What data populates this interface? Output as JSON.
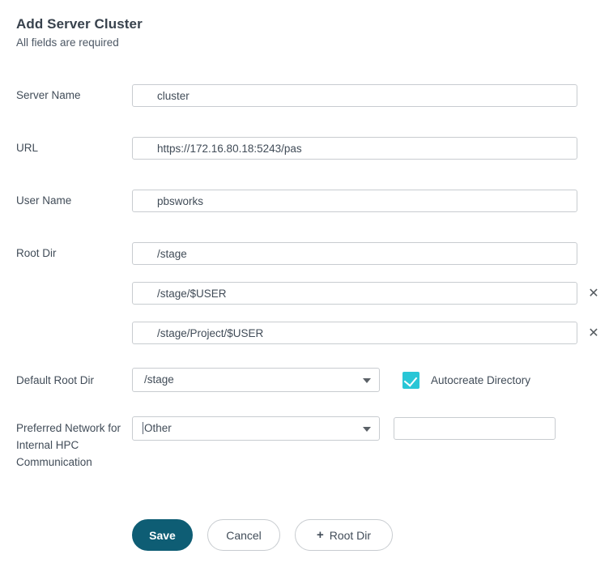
{
  "header": {
    "title": "Add Server Cluster",
    "subtitle": "All fields are required"
  },
  "fields": {
    "server_name": {
      "label": "Server Name",
      "value": "cluster",
      "placeholder": ""
    },
    "url": {
      "label": "URL",
      "value": "https://172.16.80.18:5243/pas",
      "placeholder": ""
    },
    "user_name": {
      "label": "User Name",
      "value": "pbsworks",
      "placeholder": ""
    },
    "root_dir": {
      "label": "Root Dir",
      "values": [
        "/stage",
        "/stage/$USER",
        "/stage/Project/$USER"
      ],
      "remove_icon": "✕",
      "remove_icon_name": "close-icon"
    },
    "default_root_dir": {
      "label": "Default Root Dir",
      "selected": "/stage",
      "options": [
        "/stage",
        "/stage/$USER",
        "/stage/Project/$USER"
      ],
      "caret_icon": "chevron-down-icon"
    },
    "autocreate_directory": {
      "label": "Autocreate Directory",
      "checked": true,
      "checkbox_color": "#29c6d6"
    },
    "preferred_network": {
      "label": "Preferred Network for Internal HPC Communication",
      "selected": "Other",
      "options": [
        "Other"
      ],
      "caret_icon": "chevron-down-icon",
      "custom_value": "",
      "custom_placeholder": ""
    }
  },
  "buttons": {
    "save": "Save",
    "cancel": "Cancel",
    "add_root_dir": "Root Dir",
    "add_root_dir_plus": "+"
  },
  "colors": {
    "primary": "#0e5d74",
    "accent": "#29c6d6",
    "border": "#c8ccd0",
    "text": "#414c58"
  }
}
